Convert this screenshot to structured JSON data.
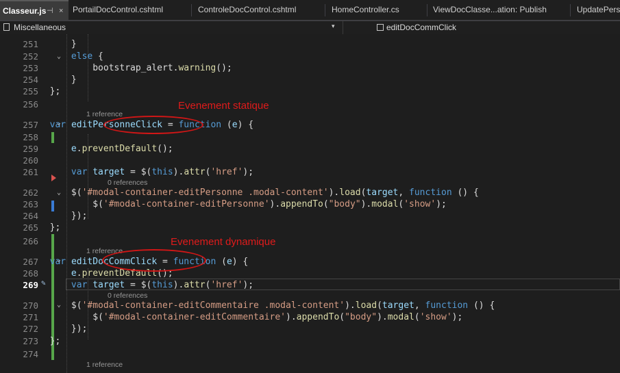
{
  "tabs": [
    {
      "label": "Classeur.js",
      "active": true
    },
    {
      "label": "PortailDocControl.cshtml"
    },
    {
      "label": "ControleDocControl.cshtml"
    },
    {
      "label": "HomeController.cs"
    },
    {
      "label": "ViewDocClasse...ation: Publish"
    },
    {
      "label": "UpdatePers"
    }
  ],
  "tab_icons": {
    "pin": "⊣",
    "close": "×"
  },
  "nav": {
    "scope": "Miscellaneous",
    "member": "editDocCommClick"
  },
  "lenses": {
    "ref257": "1 reference",
    "ref261": "0 references",
    "ref267": "1 reference",
    "ref269": "0 references",
    "ref_end": "1 reference"
  },
  "annotations": {
    "static": "Evenement statique",
    "dynamic": "Evenement dynamique"
  },
  "lines": [
    {
      "n": "251",
      "code": "            }"
    },
    {
      "n": "252",
      "code": "            else {"
    },
    {
      "n": "253",
      "code": "                bootstrap_alert.warning();"
    },
    {
      "n": "254",
      "code": "            }"
    },
    {
      "n": "255",
      "code": "        };"
    },
    {
      "n": "256",
      "code": ""
    },
    {
      "n": "257",
      "code": "        var editPersonneClick = function (e) {"
    },
    {
      "n": "258",
      "code": ""
    },
    {
      "n": "259",
      "code": "            e.preventDefault();"
    },
    {
      "n": "260",
      "code": ""
    },
    {
      "n": "261",
      "code": "            var target = $(this).attr('href');"
    },
    {
      "n": "262",
      "code": "            $('#modal-container-editPersonne .modal-content').load(target, function () {"
    },
    {
      "n": "263",
      "code": "                $('#modal-container-editPersonne').appendTo(\"body\").modal('show');"
    },
    {
      "n": "264",
      "code": "            });"
    },
    {
      "n": "265",
      "code": "        };"
    },
    {
      "n": "266",
      "code": ""
    },
    {
      "n": "267",
      "code": "        var editDocCommClick = function (e) {"
    },
    {
      "n": "268",
      "code": "            e.preventDefault();"
    },
    {
      "n": "269",
      "code": "            var target = $(this).attr('href');"
    },
    {
      "n": "270",
      "code": "            $('#modal-container-editCommentaire .modal-content').load(target, function () {"
    },
    {
      "n": "271",
      "code": "                $('#modal-container-editCommentaire').appendTo(\"body\").modal('show');"
    },
    {
      "n": "272",
      "code": "            });"
    },
    {
      "n": "273",
      "code": "        };"
    },
    {
      "n": "274",
      "code": ""
    }
  ]
}
